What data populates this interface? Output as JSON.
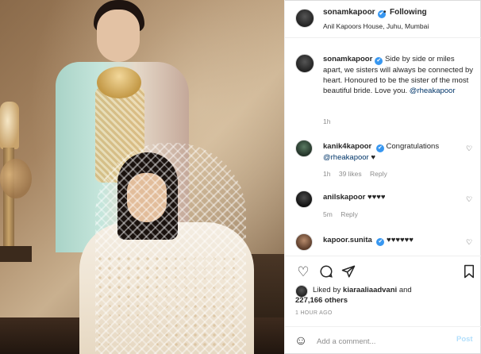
{
  "post": {
    "username": "sonamkapoor",
    "following_label": "Following",
    "location": "Anil Kapoors House, Juhu, Mumbai",
    "verified_icon": "verified-badge-icon"
  },
  "caption": {
    "username": "sonamkapoor",
    "text": "Side by side or miles apart, we sisters will always be connected by heart. Honoured to be the sister of the most beautiful bride. Love you.",
    "mention": "@rheakapoor",
    "time": "1h"
  },
  "comments": [
    {
      "username": "kanik4kapoor",
      "text": "Congratulations",
      "mention": "@rheakapoor",
      "text_suffix": "♥",
      "time": "1h",
      "likes": "39 likes",
      "reply": "Reply"
    },
    {
      "username": "anilskapoor",
      "text": "♥♥♥♥",
      "time": "5m",
      "reply": "Reply"
    },
    {
      "username": "kapoor.sunita",
      "text": "♥♥♥♥♥♥"
    }
  ],
  "actions": {
    "like_icon": "heart-icon",
    "comment_icon": "comment-icon",
    "share_icon": "share-icon",
    "save_icon": "bookmark-icon"
  },
  "likes": {
    "liked_by_prefix": "Liked by",
    "liked_by_user": "kiaraaliaadvani",
    "and": "and",
    "others": "227,166 others"
  },
  "posted_time": "1 HOUR AGO",
  "add_comment": {
    "placeholder": "Add a comment...",
    "post_label": "Post"
  },
  "colors": {
    "verified": "#3897f0",
    "post_button": "#b2dffc",
    "muted": "#8e8e8e"
  }
}
